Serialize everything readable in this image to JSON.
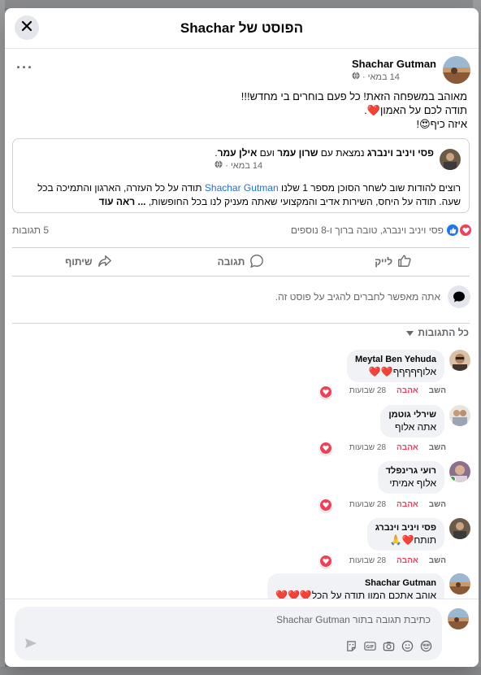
{
  "modal": {
    "title": "הפוסט של Shachar",
    "close_icon": "close-icon"
  },
  "post": {
    "author": "Shachar Gutman",
    "time": "14 במאי",
    "audience_icon": "globe-icon",
    "more_label": "···",
    "lines": [
      "מאוהב במשפחה הזאת! כל פעם בוחרים בי מחדש!!!",
      "תודה לכם על האמון",
      "איזה כיף"
    ]
  },
  "shared": {
    "author": "פסי ויניב וינברג",
    "with_text": "נמצאת עם",
    "tag1": "שרון עמר",
    "and_text": "ועם",
    "tag2": "אילן עמר",
    "time": "14 במאי",
    "body_pre": "רוצים להודות שוב לשחר הסוכן מספר 1 שלנו",
    "body_link": "Shachar Gutman",
    "body_post": "תודה על כל העזרה, הארגון והתמיכה בכל שעה. תודה על היחס, השירות אדיב והמקצועי שאתה מעניק לנו בכל החופשות,",
    "see_more": "... ראה עוד"
  },
  "reactions": {
    "names": "פסי ויניב וינברג, טובה ברוך ו-8 נוספים",
    "comments_count": "5 תגובות",
    "colors": {
      "like": "#1877f2",
      "love": "#f33e58"
    }
  },
  "actions": {
    "like": "לייק",
    "comment": "תגובה",
    "share": "שיתוף"
  },
  "notice": "אתה מאפשר לחברים להגיב על פוסט זה.",
  "all_comments": "כל התגובות",
  "comments": [
    {
      "author": "Meytal Ben Yehuda",
      "text": "אלוףףףףף",
      "emoji": "❤️❤️",
      "time": "28 שבועות",
      "love": "אהבה",
      "reply": "השב"
    },
    {
      "author": "שירלי גוטמן",
      "text": "אתה אלוף",
      "emoji": "",
      "time": "28 שבועות",
      "love": "אהבה",
      "reply": "השב"
    },
    {
      "author": "רועי גרינפלד",
      "text": "אלוף אמיתי",
      "emoji": "",
      "time": "28 שבועות",
      "love": "אהבה",
      "reply": "השב"
    },
    {
      "author": "פסי ויניב וינברג",
      "text": "תותח",
      "emoji": "❤️🙏",
      "time": "28 שבועות",
      "love": "אהבה",
      "reply": "השב"
    },
    {
      "author": "Shachar Gutman",
      "text": "אוהב אתכם המון תודה על הכל",
      "emoji": "❤️❤️❤️",
      "time": "",
      "love": "",
      "reply": ""
    }
  ],
  "composer": {
    "placeholder": "כתיבת תגובה בתור Shachar Gutman"
  }
}
